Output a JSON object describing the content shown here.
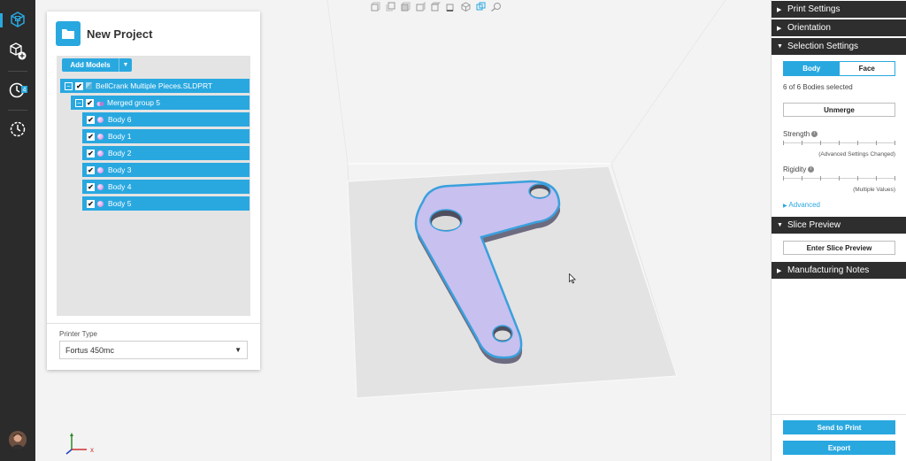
{
  "project": {
    "title": "New Project",
    "add_models_label": "Add Models",
    "tree": {
      "root_label": "BellCrank Multiple Pieces.SLDPRT",
      "group_label": "Merged group 5",
      "bodies": [
        "Body 6",
        "Body 1",
        "Body 2",
        "Body 3",
        "Body 4",
        "Body 5"
      ]
    },
    "printer_type_label": "Printer Type",
    "printer_type_value": "Fortus 450mc"
  },
  "rail": {
    "history_badge": "4"
  },
  "viewport": {
    "axis_x_label": "x"
  },
  "right_panel": {
    "print_settings": "Print Settings",
    "orientation": "Orientation",
    "selection_settings": "Selection Settings",
    "toggle_body": "Body",
    "toggle_face": "Face",
    "selected_status": "6 of 6 Bodies selected",
    "unmerge_label": "Unmerge",
    "strength_label": "Strength",
    "strength_note": "(Advanced Settings Changed)",
    "rigidity_label": "Rigidity",
    "rigidity_note": "(Multiple Values)",
    "advanced_label": "Advanced",
    "slice_preview": "Slice Preview",
    "enter_slice_preview": "Enter Slice Preview",
    "manufacturing_notes": "Manufacturing Notes",
    "send_to_print": "Send to Print",
    "export": "Export"
  },
  "colors": {
    "accent": "#29a8e0",
    "rail": "#2b2b2b",
    "section_header": "#2e2e2e",
    "part_fill": "#c8c0ef",
    "part_outline": "#3aa0dd"
  },
  "icons": {
    "toolbar": [
      "view-front-icon",
      "view-back-icon",
      "view-left-icon",
      "view-right-icon",
      "view-top-icon",
      "view-bottom-icon",
      "view-iso-icon",
      "view-fit-icon",
      "zoom-search-icon"
    ]
  }
}
